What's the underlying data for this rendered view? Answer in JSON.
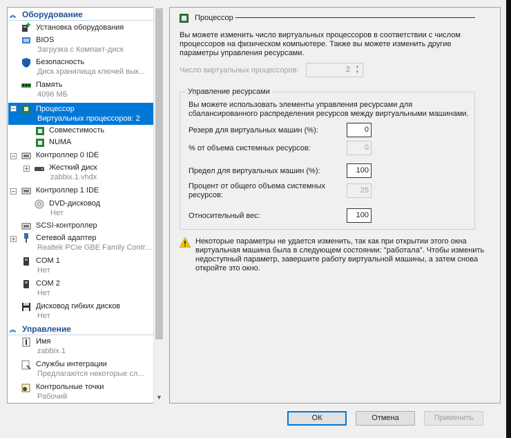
{
  "tree": {
    "hardware_header": "Оборудование",
    "management_header": "Управление",
    "items": [
      {
        "name": "Установка оборудования",
        "sub": ""
      },
      {
        "name": "BIOS",
        "sub": "Загрузка с Компакт-диск"
      },
      {
        "name": "Безопасность",
        "sub": "Диск хранилища ключей вык..."
      },
      {
        "name": "Память",
        "sub": "4096 МБ"
      },
      {
        "name": "Процессор",
        "sub": "Виртуальных процессоров: 2"
      },
      {
        "name": "Совместимость",
        "sub": ""
      },
      {
        "name": "NUMA",
        "sub": ""
      },
      {
        "name": "Контроллер 0 IDE",
        "sub": ""
      },
      {
        "name": "Жесткий диск",
        "sub": "zabbix.1.vhdx"
      },
      {
        "name": "Контроллер 1 IDE",
        "sub": ""
      },
      {
        "name": "DVD-дисковод",
        "sub": "Нет"
      },
      {
        "name": "SCSI-контроллер",
        "sub": ""
      },
      {
        "name": "Сетевой адаптер",
        "sub": "Realtek PCIe GBE Family Contr..."
      },
      {
        "name": "COM 1",
        "sub": "Нет"
      },
      {
        "name": "COM 2",
        "sub": "Нет"
      },
      {
        "name": "Дисковод гибких дисков",
        "sub": "Нет"
      }
    ],
    "mgmt_items": [
      {
        "name": "Имя",
        "sub": "zabbix.1"
      },
      {
        "name": "Службы интеграции",
        "sub": "Предлагаются некоторые сл..."
      },
      {
        "name": "Контрольные точки",
        "sub": "Рабочий"
      }
    ]
  },
  "panel": {
    "title": "Процессор",
    "description": "Вы можете изменить число виртуальных процессоров в соответствии с числом процессоров на физическом компьютере. Также вы можете изменить другие параметры управления ресурсами.",
    "vcpu_label": "Число виртуальных процессоров:",
    "vcpu_value": "2",
    "group_title": "Управление ресурсами",
    "group_desc": "Вы можете использовать элементы управления ресурсами для сбалансированного распределения ресурсов между виртуальными машинами.",
    "reserve_label": "Резерв для виртуальных машин (%):",
    "reserve_value": "0",
    "reserve_pct_label": "% от объема системных ресурсов:",
    "reserve_pct_value": "0",
    "limit_label": "Предел для виртуальных машин (%):",
    "limit_value": "100",
    "limit_pct_label": "Процент от общего объема системных ресурсов:",
    "limit_pct_value": "25",
    "weight_label": "Относительный вес:",
    "weight_value": "100",
    "warning": "Некоторые параметры не удается изменить, так как при открытии этого окна виртуальная машина была в следующем состоянии: \"работала\". Чтобы изменить недоступный параметр, завершите работу виртуальной машины, а затем снова откройте это окно."
  },
  "buttons": {
    "ok": "ОК",
    "cancel": "Отмена",
    "apply": "Применить"
  }
}
